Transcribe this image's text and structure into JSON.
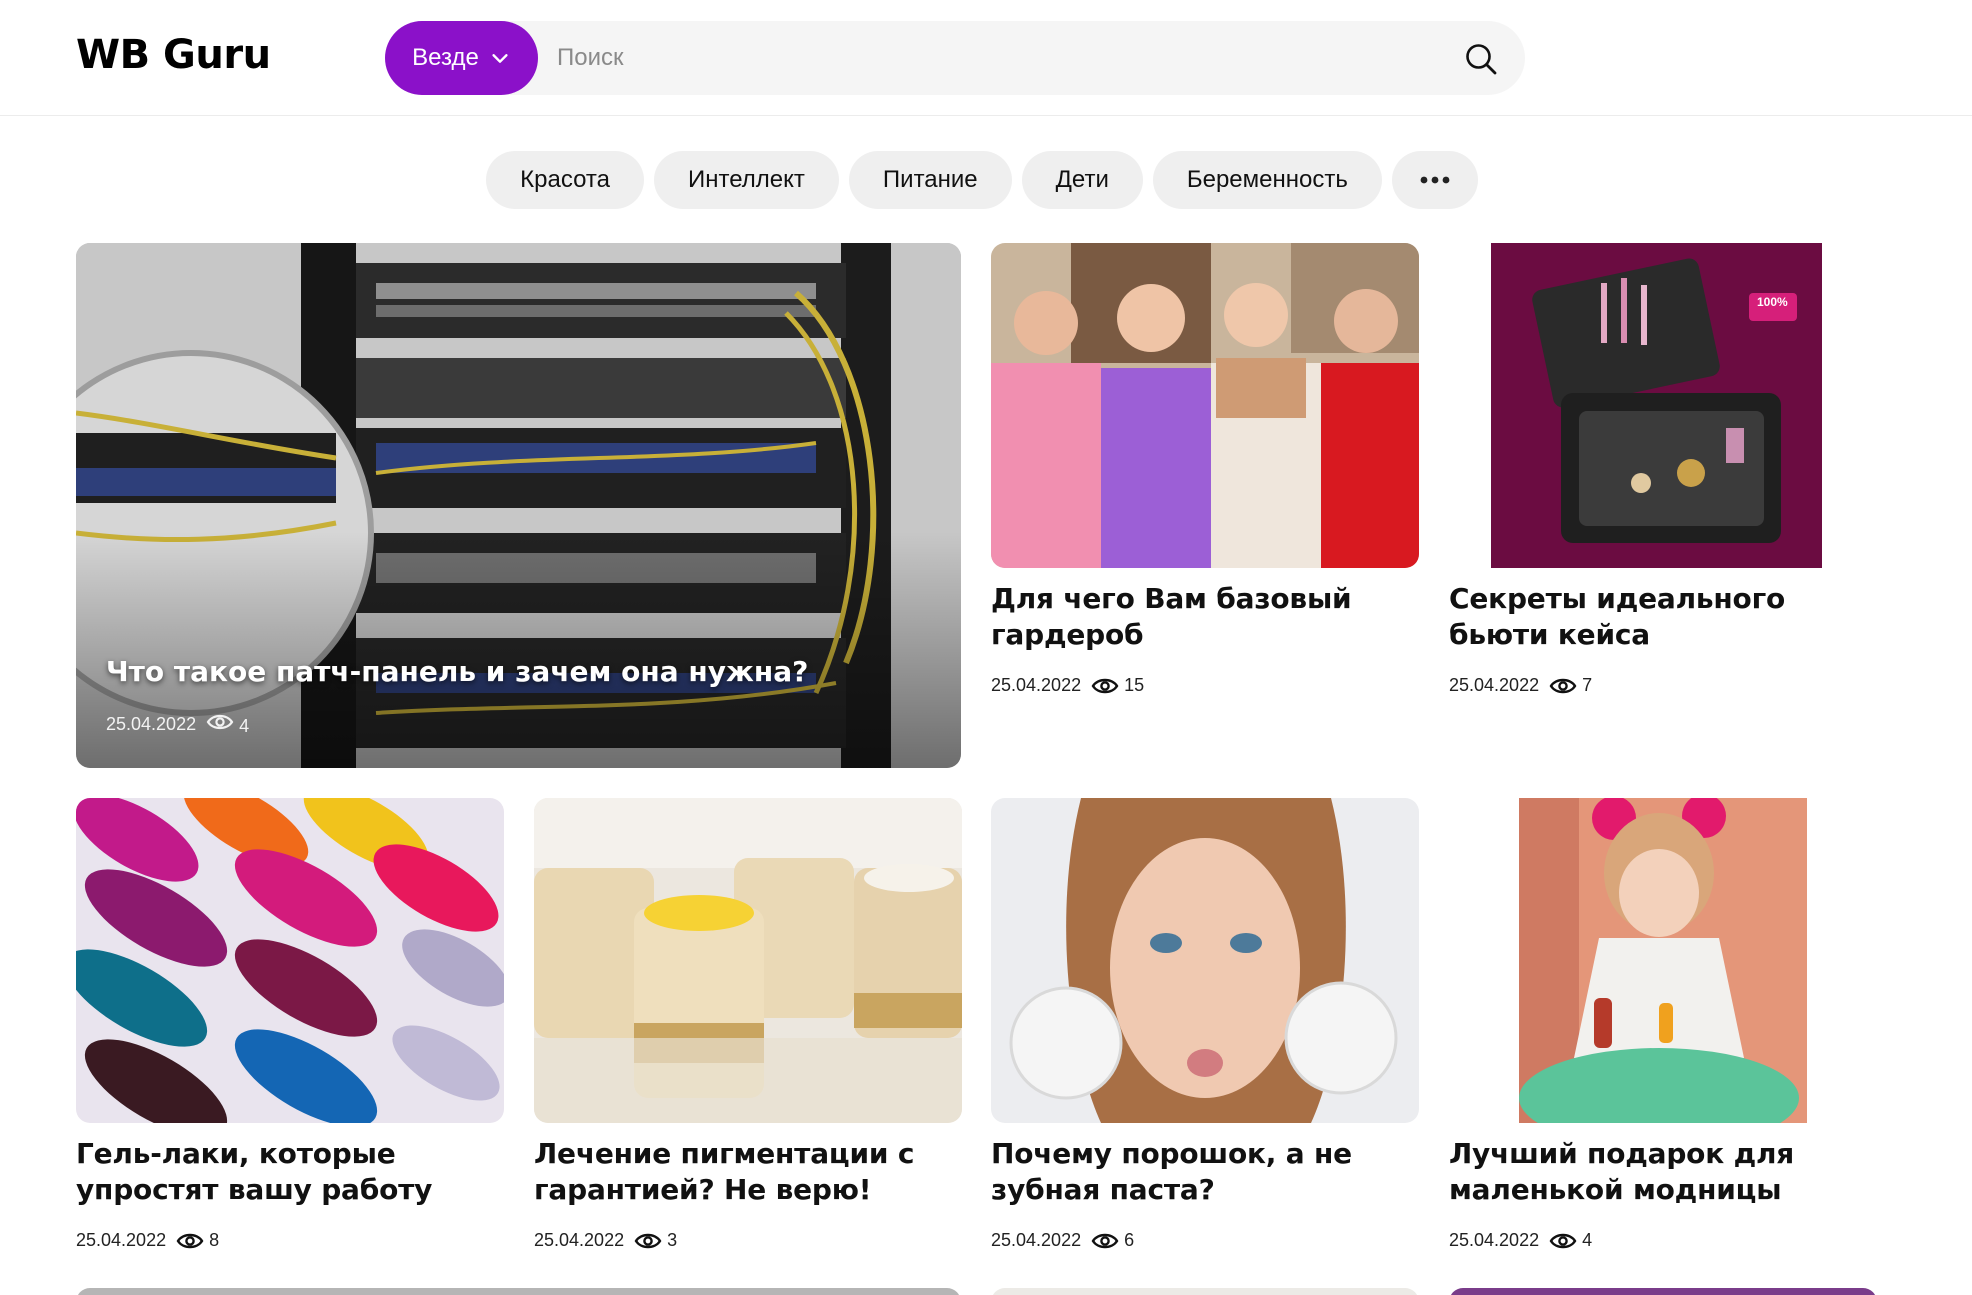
{
  "header": {
    "logo": "WB Guru",
    "scope_label": "Везде",
    "search_placeholder": "Поиск"
  },
  "categories": [
    "Красота",
    "Интеллект",
    "Питание",
    "Дети",
    "Беременность"
  ],
  "more_label": "•••",
  "colors": {
    "accent": "#8b11c9",
    "chip_bg": "#efefef",
    "search_bg": "#f5f5f5"
  },
  "articles": [
    {
      "title": "Что такое патч-панель и зачем она нужна?",
      "date": "25.04.2022",
      "views": "4",
      "image": "server-rack-patch-panel"
    },
    {
      "title": "Для чего Вам базовый гардероб",
      "date": "25.04.2022",
      "views": "15",
      "image": "four-women-in-hoodies"
    },
    {
      "title": "Секреты идеального бьюти кейса",
      "date": "25.04.2022",
      "views": "7",
      "image": "cosmetic-case",
      "badge": "100%"
    },
    {
      "title": "Гель-лаки, которые упростят вашу работу",
      "date": "25.04.2022",
      "views": "8",
      "image": "nail-polish-swatches"
    },
    {
      "title": "Лечение пигментации с гарантией? Не верю!",
      "date": "25.04.2022",
      "views": "3",
      "image": "cream-jars"
    },
    {
      "title": "Почему порошок, а не зубная паста?",
      "date": "25.04.2022",
      "views": "6",
      "image": "woman-with-tooth-powder"
    },
    {
      "title": "Лучший подарок для маленькой модницы",
      "date": "25.04.2022",
      "views": "4",
      "image": "little-girl-with-nail-polish"
    }
  ]
}
